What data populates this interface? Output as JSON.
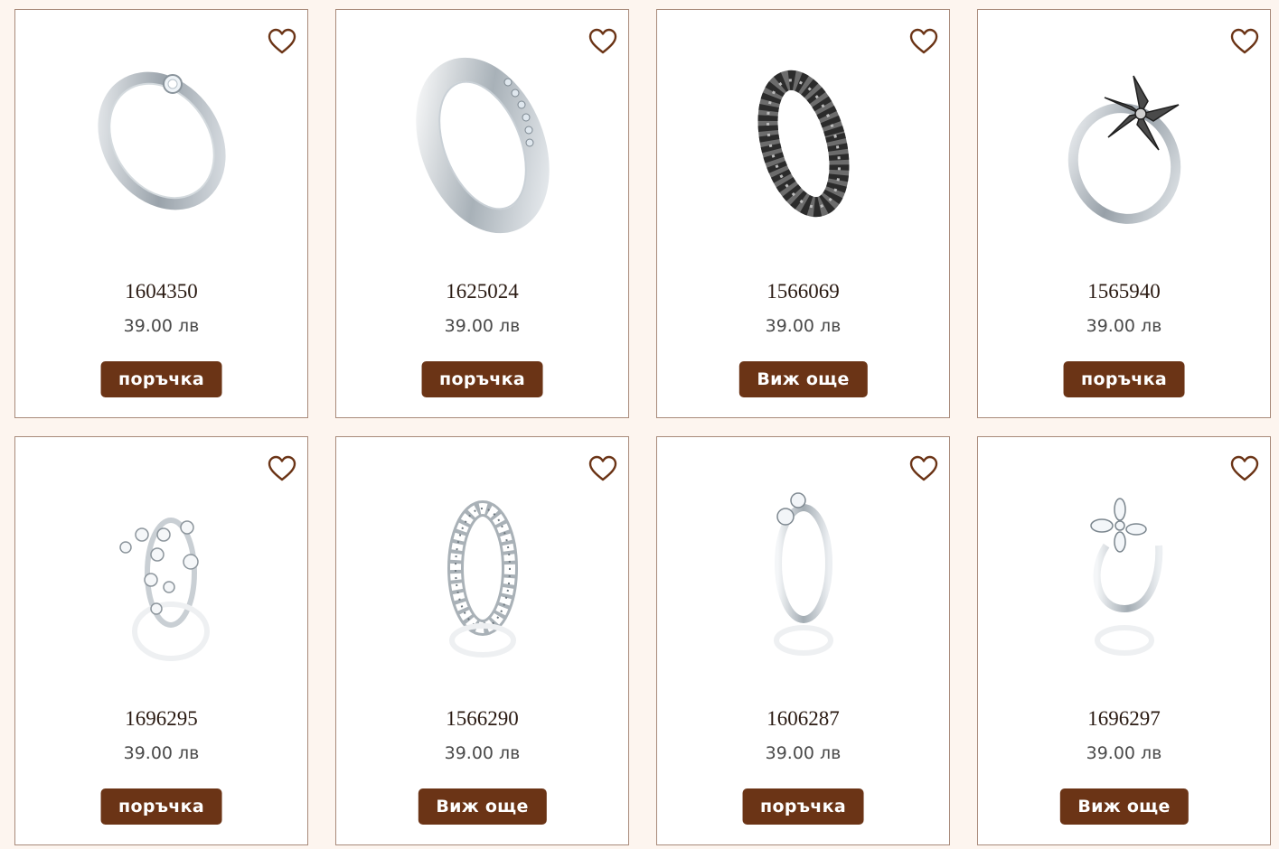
{
  "theme": {
    "accent": "#6b3416",
    "background": "#fdf5ef",
    "border": "#a88a7a"
  },
  "products": [
    {
      "code": "1604350",
      "price": "39.00 лв",
      "button": "поръчка",
      "icon": "heart-outline-icon",
      "image": "solitaire-ring"
    },
    {
      "code": "1625024",
      "price": "39.00 лв",
      "button": "поръчка",
      "icon": "heart-outline-icon",
      "image": "channel-stone-band"
    },
    {
      "code": "1566069",
      "price": "39.00 лв",
      "button": "Виж още",
      "icon": "heart-outline-icon",
      "image": "oxidized-pattern-band"
    },
    {
      "code": "1565940",
      "price": "39.00 лв",
      "button": "поръчка",
      "icon": "heart-outline-icon",
      "image": "flower-ring"
    },
    {
      "code": "1696295",
      "price": "39.00 лв",
      "button": "поръчка",
      "icon": "heart-outline-icon",
      "image": "cross-crystal-ring"
    },
    {
      "code": "1566290",
      "price": "39.00 лв",
      "button": "Виж още",
      "icon": "heart-outline-icon",
      "image": "filigree-band"
    },
    {
      "code": "1606287",
      "price": "39.00 лв",
      "button": "поръчка",
      "icon": "heart-outline-icon",
      "image": "double-stone-ring"
    },
    {
      "code": "1696297",
      "price": "39.00 лв",
      "button": "Виж още",
      "icon": "heart-outline-icon",
      "image": "flower-open-ring"
    }
  ]
}
